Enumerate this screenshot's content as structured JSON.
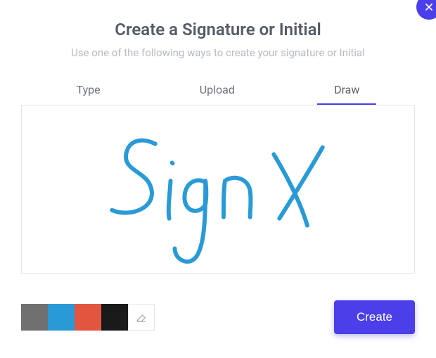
{
  "modal": {
    "title": "Create a Signature or Initial",
    "subtitle": "Use one of the following ways to create your signature or Initial"
  },
  "tabs": {
    "type": "Type",
    "upload": "Upload",
    "draw": "Draw",
    "active": "draw"
  },
  "signature": {
    "drawn_text": "SignX",
    "stroke_color": "#2a9ad6"
  },
  "colors": {
    "gray": "#707070",
    "blue": "#2a9ad6",
    "red": "#e2553f",
    "black": "#1a1a1a",
    "selected": "blue"
  },
  "buttons": {
    "create": "Create"
  }
}
